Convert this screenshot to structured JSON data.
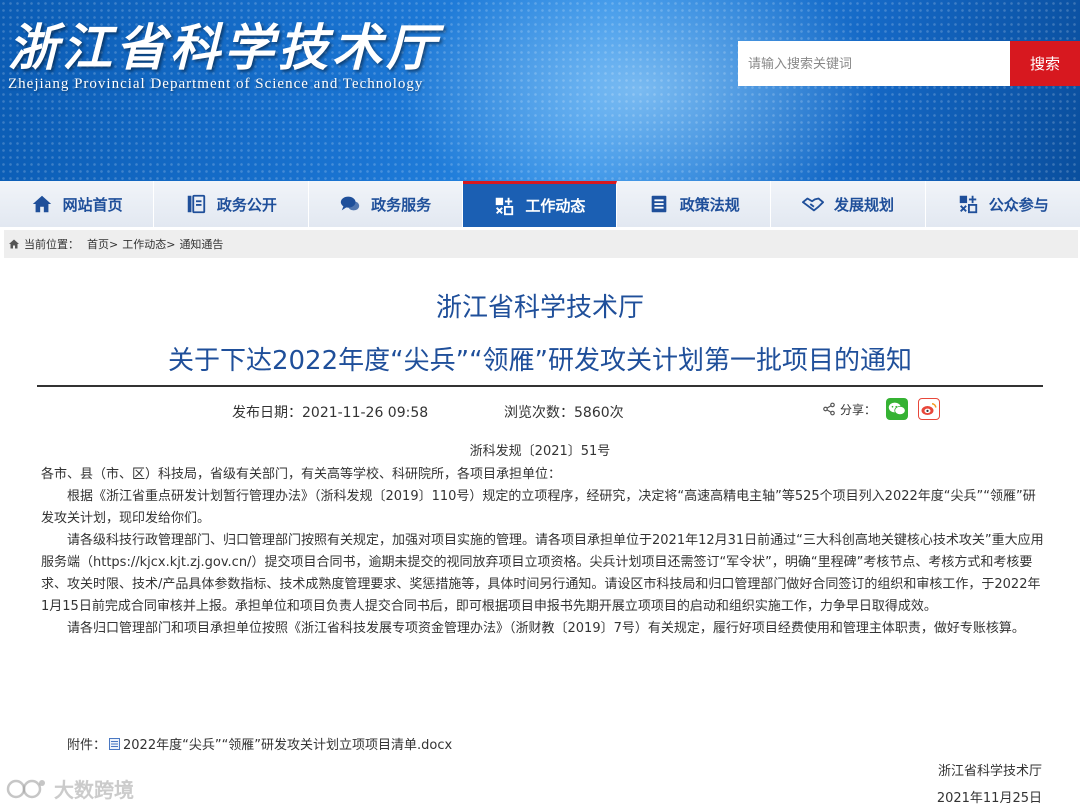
{
  "header": {
    "title_cn": "浙江省科学技术厅",
    "title_en": "Zhejiang Provincial Department of Science and Technology",
    "search_placeholder": "请输入搜索关键词",
    "search_button": "搜索"
  },
  "nav": {
    "items": [
      {
        "label": "网站首页",
        "icon": "home-icon"
      },
      {
        "label": "政务公开",
        "icon": "document-icon"
      },
      {
        "label": "政务服务",
        "icon": "chat-icon"
      },
      {
        "label": "工作动态",
        "icon": "work-icon",
        "active": true
      },
      {
        "label": "政策法规",
        "icon": "list-icon"
      },
      {
        "label": "发展规划",
        "icon": "handshake-icon"
      },
      {
        "label": "公众参与",
        "icon": "people-icon"
      }
    ],
    "active_color": "#1b5fb3",
    "accent": "#d7181f"
  },
  "breadcrumb": {
    "prefix": "当前位置：",
    "items": [
      "首页>",
      "工作动态>",
      "通知通告"
    ]
  },
  "article": {
    "org": "浙江省科学技术厅",
    "title": "关于下达2022年度“尖兵”“领雁”研发攻关计划第一批项目的通知",
    "publish_label": "发布日期：2021-11-26 09:58",
    "views_label": "浏览次数：5860次",
    "share_label": "分享：",
    "doc_no": "浙科发规〔2021〕51号",
    "salutation": "各市、县（市、区）科技局，省级有关部门，有关高等学校、科研院所，各项目承担单位：",
    "paragraphs": [
      "根据《浙江省重点研发计划暂行管理办法》（浙科发规〔2019〕110号）规定的立项程序，经研究，决定将“高速高精电主轴”等525个项目列入2022年度“尖兵”“领雁”研发攻关计划，现印发给你们。",
      "请各级科技行政管理部门、归口管理部门按照有关规定，加强对项目实施的管理。请各项目承担单位于2021年12月31日前通过“三大科创高地关键核心技术攻关”重大应用服务端（https://kjcx.kjt.zj.gov.cn/）提交项目合同书，逾期未提交的视同放弃项目立项资格。尖兵计划项目还需签订“军令状”，明确“里程碑”考核节点、考核方式和考核要求、攻关时限、技术/产品具体参数指标、技术成熟度管理要求、奖惩措施等，具体时间另行通知。请设区市科技局和归口管理部门做好合同签订的组织和审核工作，于2022年1月15日前完成合同审核并上报。承担单位和项目负责人提交合同书后，即可根据项目申报书先期开展立项项目的启动和组织实施工作，力争早日取得成效。",
      "请各归口管理部门和项目承担单位按照《浙江省科技发展专项资金管理办法》（浙财教〔2019〕7号）有关规定，履行好项目经费使用和管理主体职责，做好专账核算。"
    ],
    "attachment_label": "附件：",
    "attachment_file": "2022年度“尖兵”“领雁”研发攻关计划立项项目清单.docx",
    "sign_org": "浙江省科学技术厅",
    "sign_date": "2021年11月25日"
  },
  "watermark": "大数跨境"
}
